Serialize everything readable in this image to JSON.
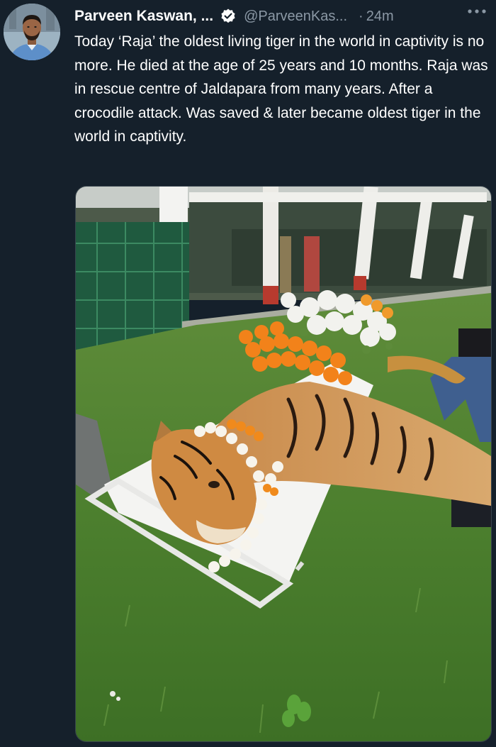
{
  "tweet": {
    "author": {
      "display_name": "Parveen Kaswan, ...",
      "handle": "@ParveenKas...",
      "verified": true,
      "avatar_icon": "profile-photo"
    },
    "separator": "·",
    "timestamp": "24m",
    "more_icon": "more-horizontal-icon",
    "text": "Today ‘Raja’ the oldest living tiger in the world in captivity is no more. He died at the age of 25 years and 10 months. Raja was in rescue centre of Jaldapara from many years. After a crocodile attack. Was saved & later became oldest tiger in the world in captivity.",
    "media": {
      "kind": "photo",
      "subject": "tiger on stretcher with marigold and white flower garlands"
    }
  },
  "colors": {
    "background": "#15202b",
    "primary_text": "#ffffff",
    "secondary_text": "#8b98a5",
    "verified_badge": "#ffffff"
  }
}
